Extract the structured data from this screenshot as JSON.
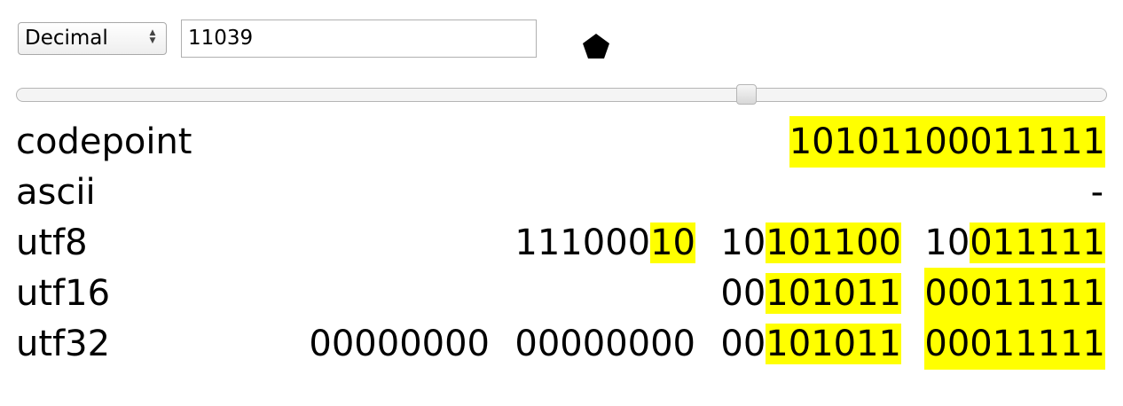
{
  "controls": {
    "format_select": "Decimal",
    "value_input": "11039"
  },
  "rows": {
    "codepoint": {
      "label": "codepoint",
      "bits": "10101100011111"
    },
    "ascii": {
      "label": "ascii",
      "value": "-"
    },
    "utf8": {
      "label": "utf8",
      "b0_plain": "111000",
      "b0_hl": "10",
      "b1_plain": "10",
      "b1_hl": "101100",
      "b2_plain": "10",
      "b2_hl": "011111"
    },
    "utf16": {
      "label": "utf16",
      "b0_plain": "00",
      "b0_hl": "101011",
      "b1_hl": "00011111"
    },
    "utf32": {
      "label": "utf32",
      "b0": "00000000",
      "b1": "00000000",
      "b2_plain": "00",
      "b2_hl": "101011",
      "b3_hl": "00011111"
    }
  },
  "colors": {
    "highlight": "#ffff00"
  },
  "icons": {
    "indicator": "pentagon-icon"
  }
}
